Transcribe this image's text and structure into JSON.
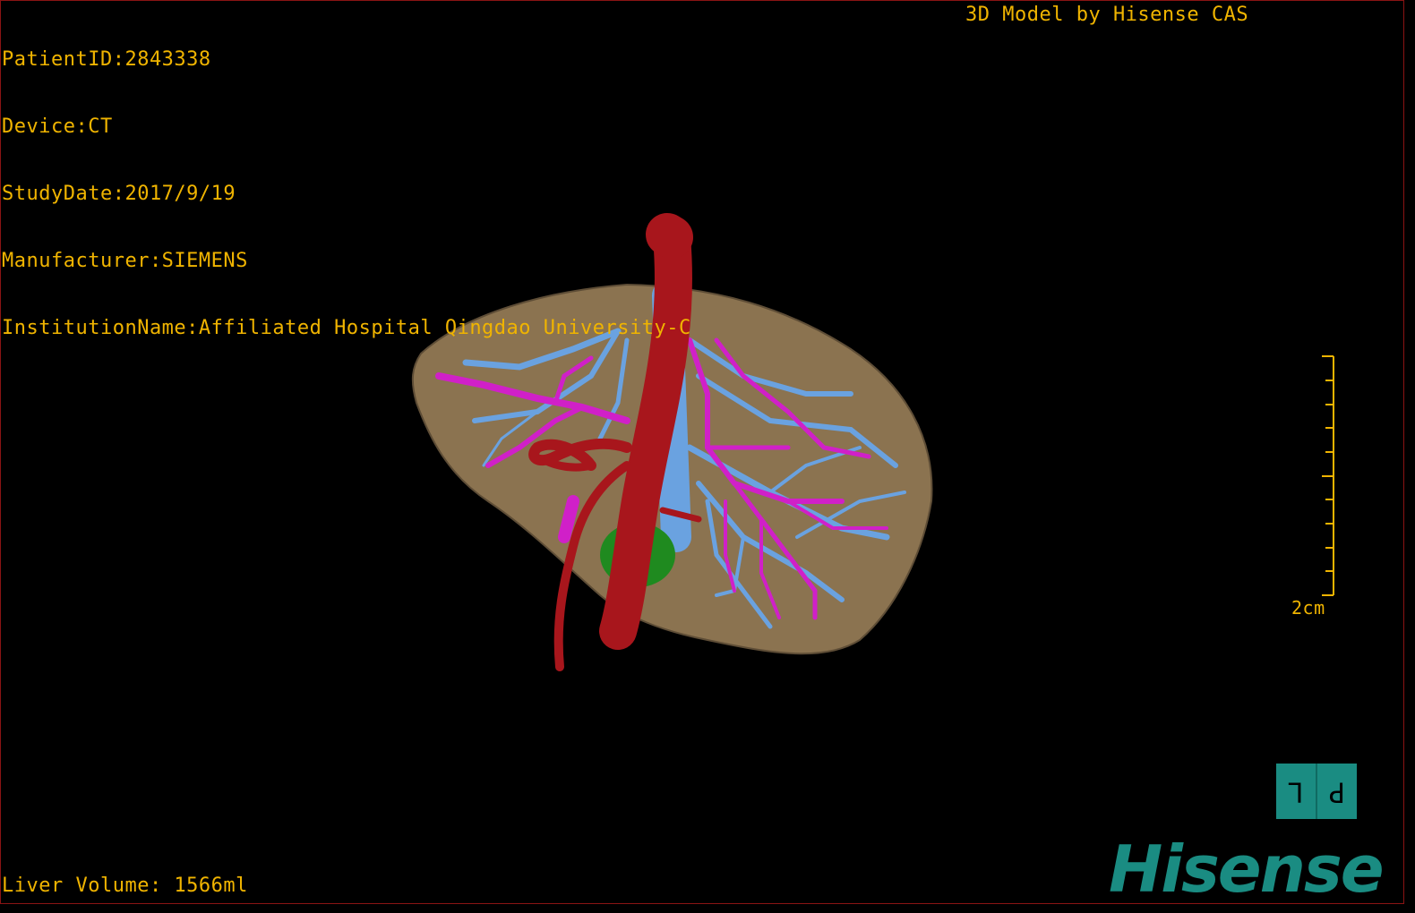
{
  "header": {
    "patient_id": "PatientID:2843338",
    "device": "Device:CT",
    "study_date": "StudyDate:2017/9/19",
    "manufacturer": "Manufacturer:SIEMENS",
    "institution": "InstitutionName:Affiliated Hospital Qingdao University-C",
    "credit": "3D Model by Hisense CAS"
  },
  "footer": {
    "liver_volume": "Liver Volume: 1566ml"
  },
  "scale_bar": {
    "label": "2cm"
  },
  "orientation_cube": {
    "left_glyph": "L",
    "right_glyph": "P"
  },
  "brand": {
    "logo_text": "Hisense"
  },
  "colors": {
    "overlay_text": "#f0b400",
    "liver": "#8b7350",
    "artery": "#a8161c",
    "portal_vein": "#d020c8",
    "hepatic_vein": "#6aa2e0",
    "gallbladder": "#1f8a1f",
    "brand": "#1a8c82"
  }
}
